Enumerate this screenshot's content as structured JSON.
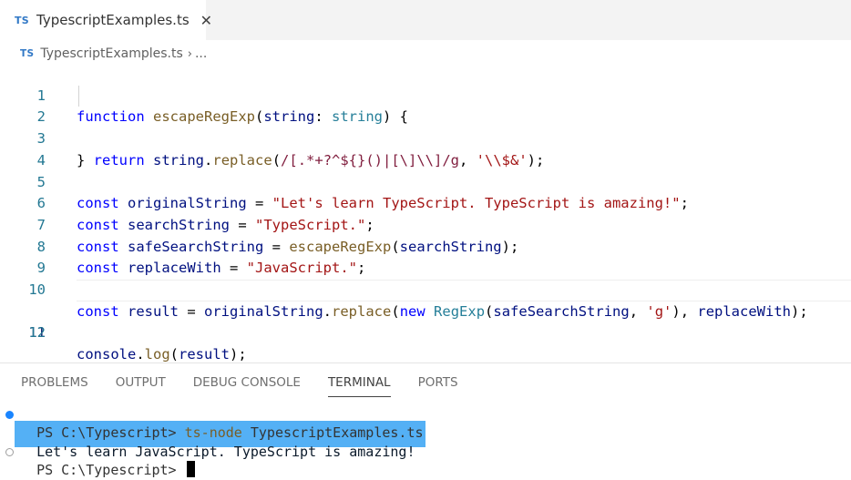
{
  "tab": {
    "badge": "TS",
    "label": "TypescriptExamples.ts",
    "close_glyph": "✕"
  },
  "breadcrumb": {
    "badge": "TS",
    "file": "TypescriptExamples.ts",
    "sep": "›",
    "ellipsis": "..."
  },
  "editor": {
    "line_numbers": [
      "1",
      "2",
      "3",
      "4",
      "5",
      "6",
      "7",
      "8",
      "9",
      "10",
      "11",
      "12"
    ],
    "active_line": 11
  },
  "panel": {
    "tabs": [
      {
        "label": "PROBLEMS",
        "active": false
      },
      {
        "label": "OUTPUT",
        "active": false
      },
      {
        "label": "DEBUG CONSOLE",
        "active": false
      },
      {
        "label": "TERMINAL",
        "active": true
      },
      {
        "label": "PORTS",
        "active": false
      }
    ]
  },
  "terminal": {
    "line1_prompt": "PS C:\\Typescript> ",
    "line1_cmd": "ts-node",
    "line1_arg": " TypescriptExamples.ts",
    "output": "Let's learn JavaScript. TypeScript is amazing!",
    "line3_prompt": "PS C:\\Typescript> "
  },
  "colors": {
    "accent": "#3178c6",
    "selection": "#54b0f5",
    "keyword": "#0000ff",
    "string": "#a31515"
  }
}
